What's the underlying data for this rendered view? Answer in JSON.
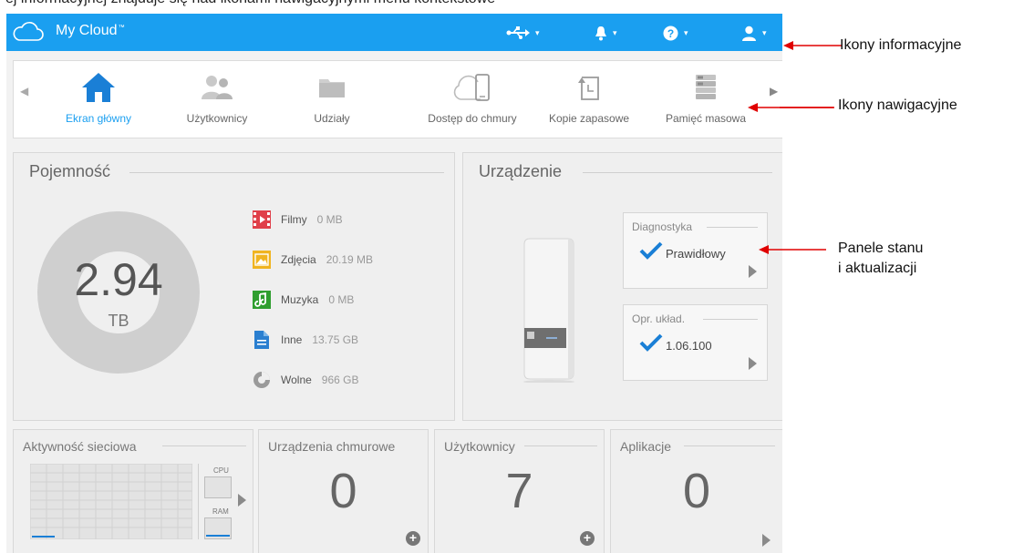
{
  "app": {
    "title": "My Cloud",
    "tm": "™",
    "accent": "#1a9ff0"
  },
  "nav": [
    {
      "label": "Ekran główny",
      "icon": "home-icon",
      "active": true
    },
    {
      "label": "Użytkownicy",
      "icon": "users-icon",
      "active": false
    },
    {
      "label": "Udziały",
      "icon": "folder-icon",
      "active": false
    },
    {
      "label": "Dostęp do chmury",
      "icon": "cloud-device-icon",
      "active": false
    },
    {
      "label": "Kopie zapasowe",
      "icon": "backup-icon",
      "active": false
    },
    {
      "label": "Pamięć masowa",
      "icon": "storage-icon",
      "active": false
    }
  ],
  "capacity": {
    "title": "Pojemność",
    "value": "2.94",
    "unit": "TB",
    "items": [
      {
        "name": "Filmy",
        "value": "0 MB",
        "icon": "video-icon",
        "color": "#e0404a"
      },
      {
        "name": "Zdjęcia",
        "value": "20.19 MB",
        "icon": "photo-icon",
        "color": "#f0b420"
      },
      {
        "name": "Muzyka",
        "value": "0 MB",
        "icon": "music-icon",
        "color": "#2f9e2f"
      },
      {
        "name": "Inne",
        "value": "13.75 GB",
        "icon": "document-icon",
        "color": "#2a7fd0"
      },
      {
        "name": "Wolne",
        "value": "966 GB",
        "icon": "pie-icon",
        "color": "#9a9a9a"
      }
    ]
  },
  "device": {
    "title": "Urządzenie",
    "diagnostics": {
      "title": "Diagnostyka",
      "value": "Prawidłowy"
    },
    "firmware": {
      "title": "Opr. układ.",
      "value": "1.06.100"
    }
  },
  "tiles": {
    "network": {
      "title": "Aktywność sieciowa",
      "cpu": "CPU",
      "ram": "RAM"
    },
    "cloud_devices": {
      "title": "Urządzenia chmurowe",
      "count": "0"
    },
    "users": {
      "title": "Użytkownicy",
      "count": "7"
    },
    "apps": {
      "title": "Aplikacje",
      "count": "0"
    }
  },
  "annotations": {
    "info_icons": "Ikony informacyjne",
    "nav_icons": "Ikony nawigacyjne",
    "panels_line1": "Panele stanu",
    "panels_line2": "i aktualizacji"
  },
  "cropped_caption": "ej informacyjnej znajduje się nad ikonami nawigacyjnymi menu kontekstowe"
}
